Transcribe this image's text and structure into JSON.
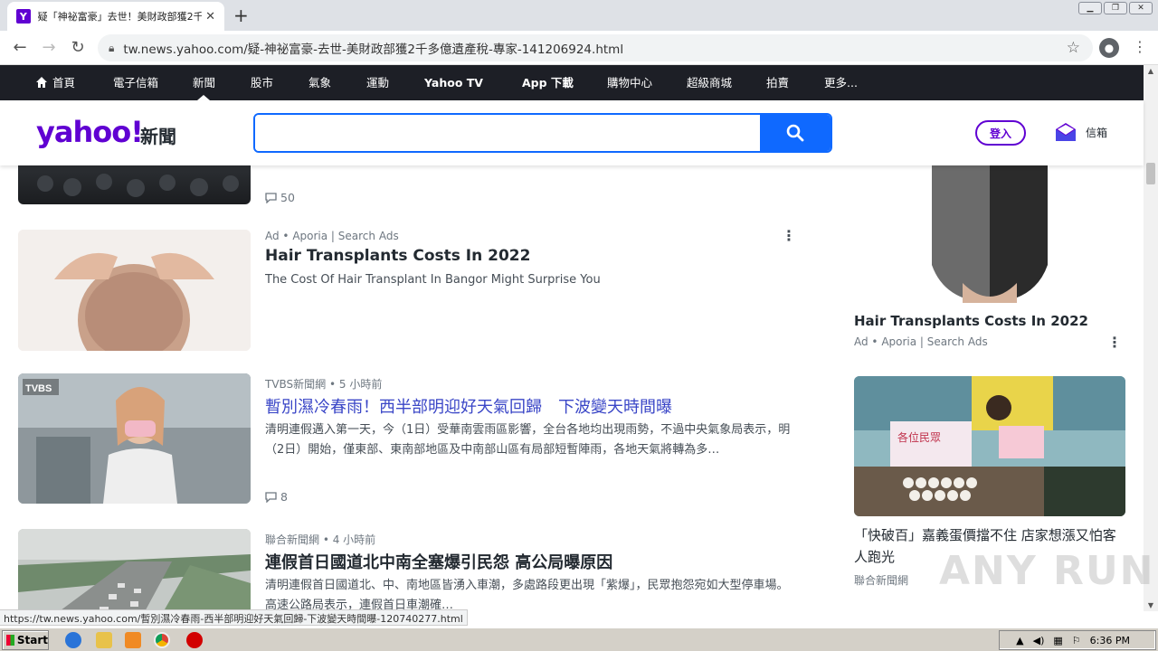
{
  "browser": {
    "tab_title": "疑「神祕富豪」去世！美財政部獲2千多億遺產稅",
    "favicon_letter": "Y",
    "url": "tw.news.yahoo.com/疑-神祕富豪-去世-美財政部獲2千多億遺產稅-專家-141206924.html",
    "status_url": "https://tw.news.yahoo.com/暫別濕冷春雨-西半部明迎好天氣回歸-下波變天時間曝-120740277.html"
  },
  "nav": {
    "home": "首頁",
    "items": [
      "電子信箱",
      "新聞",
      "股市",
      "氣象",
      "運動",
      "Yahoo TV",
      "App 下載",
      "購物中心",
      "超級商城",
      "拍賣",
      "更多..."
    ],
    "active": "新聞"
  },
  "header": {
    "logo": "yahoo!",
    "logo_sub": "新聞",
    "search_value": "",
    "login": "登入",
    "mail": "信箱"
  },
  "feed": {
    "top_comments": "50",
    "ad": {
      "meta": "Ad • Aporia | Search Ads",
      "title": "Hair Transplants Costs In 2022",
      "body": "The Cost Of Hair Transplant In Bangor Might Surprise You"
    },
    "article1": {
      "meta": "TVBS新聞網 • 5 小時前",
      "title": "暫別濕冷春雨！西半部明迎好天氣回歸　下波變天時間曝",
      "body": "清明連假邁入第一天，今（1日）受華南雲雨區影響，全台各地均出現雨勢，不過中央氣象局表示，明（2日）開始，僅東部、東南部地區及中南部山區有局部短暫陣雨，各地天氣將轉為多…",
      "comments": "8",
      "thumb_logo": "TVBS"
    },
    "article2": {
      "meta": "聯合新聞網 • 4 小時前",
      "title": "連假首日國道北中南全塞爆引民怨 高公局曝原因",
      "body": "清明連假首日國道北、中、南地區皆湧入車潮，多處路段更出現「紫爆」，民眾抱怨宛如大型停車場。高速公路局表示，連假首日車潮確…"
    }
  },
  "rail": {
    "ad_title": "Hair Transplants Costs In 2022",
    "ad_meta": "Ad • Aporia | Search Ads",
    "news_title": "「快破百」嘉義蛋價擋不住 店家想漲又怕客人跑光",
    "news_meta": "聯合新聞網",
    "sign_text": "各位民眾"
  },
  "watermark": "ANY RUN",
  "taskbar": {
    "start": "Start",
    "clock": "6:36 PM"
  },
  "colors": {
    "yahoo_purple": "#6001d2",
    "search_blue": "#0f69ff",
    "nav_bg": "#1d1f26"
  }
}
